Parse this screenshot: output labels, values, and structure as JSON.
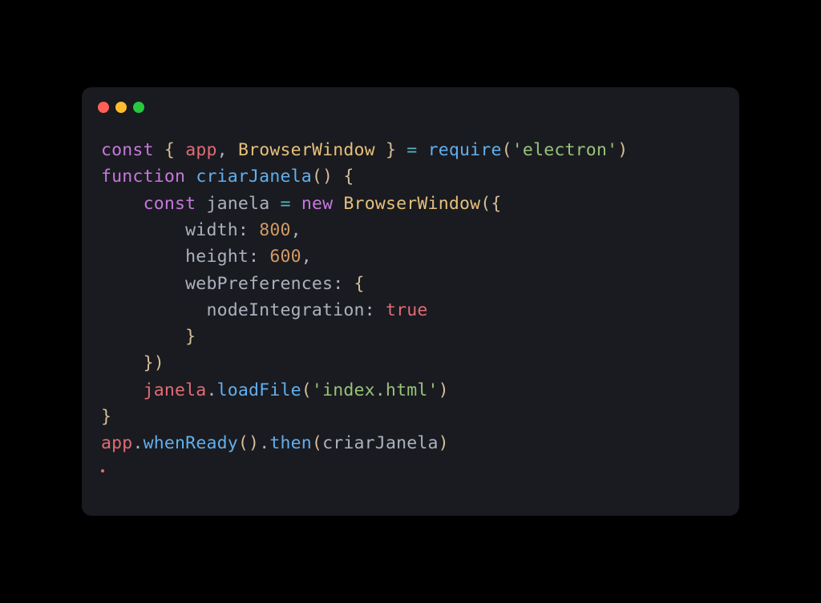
{
  "window": {
    "traffic_lights": [
      "close",
      "minimize",
      "maximize"
    ]
  },
  "code": {
    "line1": {
      "const": "const",
      "brace_open": "{",
      "app": "app",
      "comma": ",",
      "BrowserWindow": "BrowserWindow",
      "brace_close": "}",
      "equals": "=",
      "require": "require",
      "paren_open": "(",
      "electron_str": "'electron'",
      "paren_close": ")"
    },
    "line2": {
      "function": "function",
      "name": "criarJanela",
      "parens": "()",
      "brace": "{"
    },
    "line3": {
      "indent": "    ",
      "const": "const",
      "janela": "janela",
      "equals": "=",
      "new": "new",
      "BrowserWindow": "BrowserWindow",
      "paren_brace": "({"
    },
    "line4": {
      "indent": "        ",
      "width": "width",
      "colon": ":",
      "val": "800",
      "comma": ","
    },
    "line5": {
      "indent": "        ",
      "height": "height",
      "colon": ":",
      "val": "600",
      "comma": ","
    },
    "line6": {
      "indent": "        ",
      "webPreferences": "webPreferences",
      "colon": ":",
      "brace": "{"
    },
    "line7": {
      "indent": "          ",
      "nodeIntegration": "nodeIntegration",
      "colon": ":",
      "true": "true"
    },
    "line8": {
      "indent": "        ",
      "brace": "}"
    },
    "line9": {
      "indent": "    ",
      "close": "})"
    },
    "line10": {
      "indent": "    ",
      "janela": "janela",
      "dot": ".",
      "loadFile": "loadFile",
      "paren_open": "(",
      "index_str": "'index.html'",
      "paren_close": ")"
    },
    "line11": {
      "brace": "}"
    },
    "line12": {
      "app": "app",
      "dot1": ".",
      "whenReady": "whenReady",
      "parens": "()",
      "dot2": ".",
      "then": "then",
      "paren_open": "(",
      "criarJanela": "criarJanela",
      "paren_close": ")"
    }
  }
}
